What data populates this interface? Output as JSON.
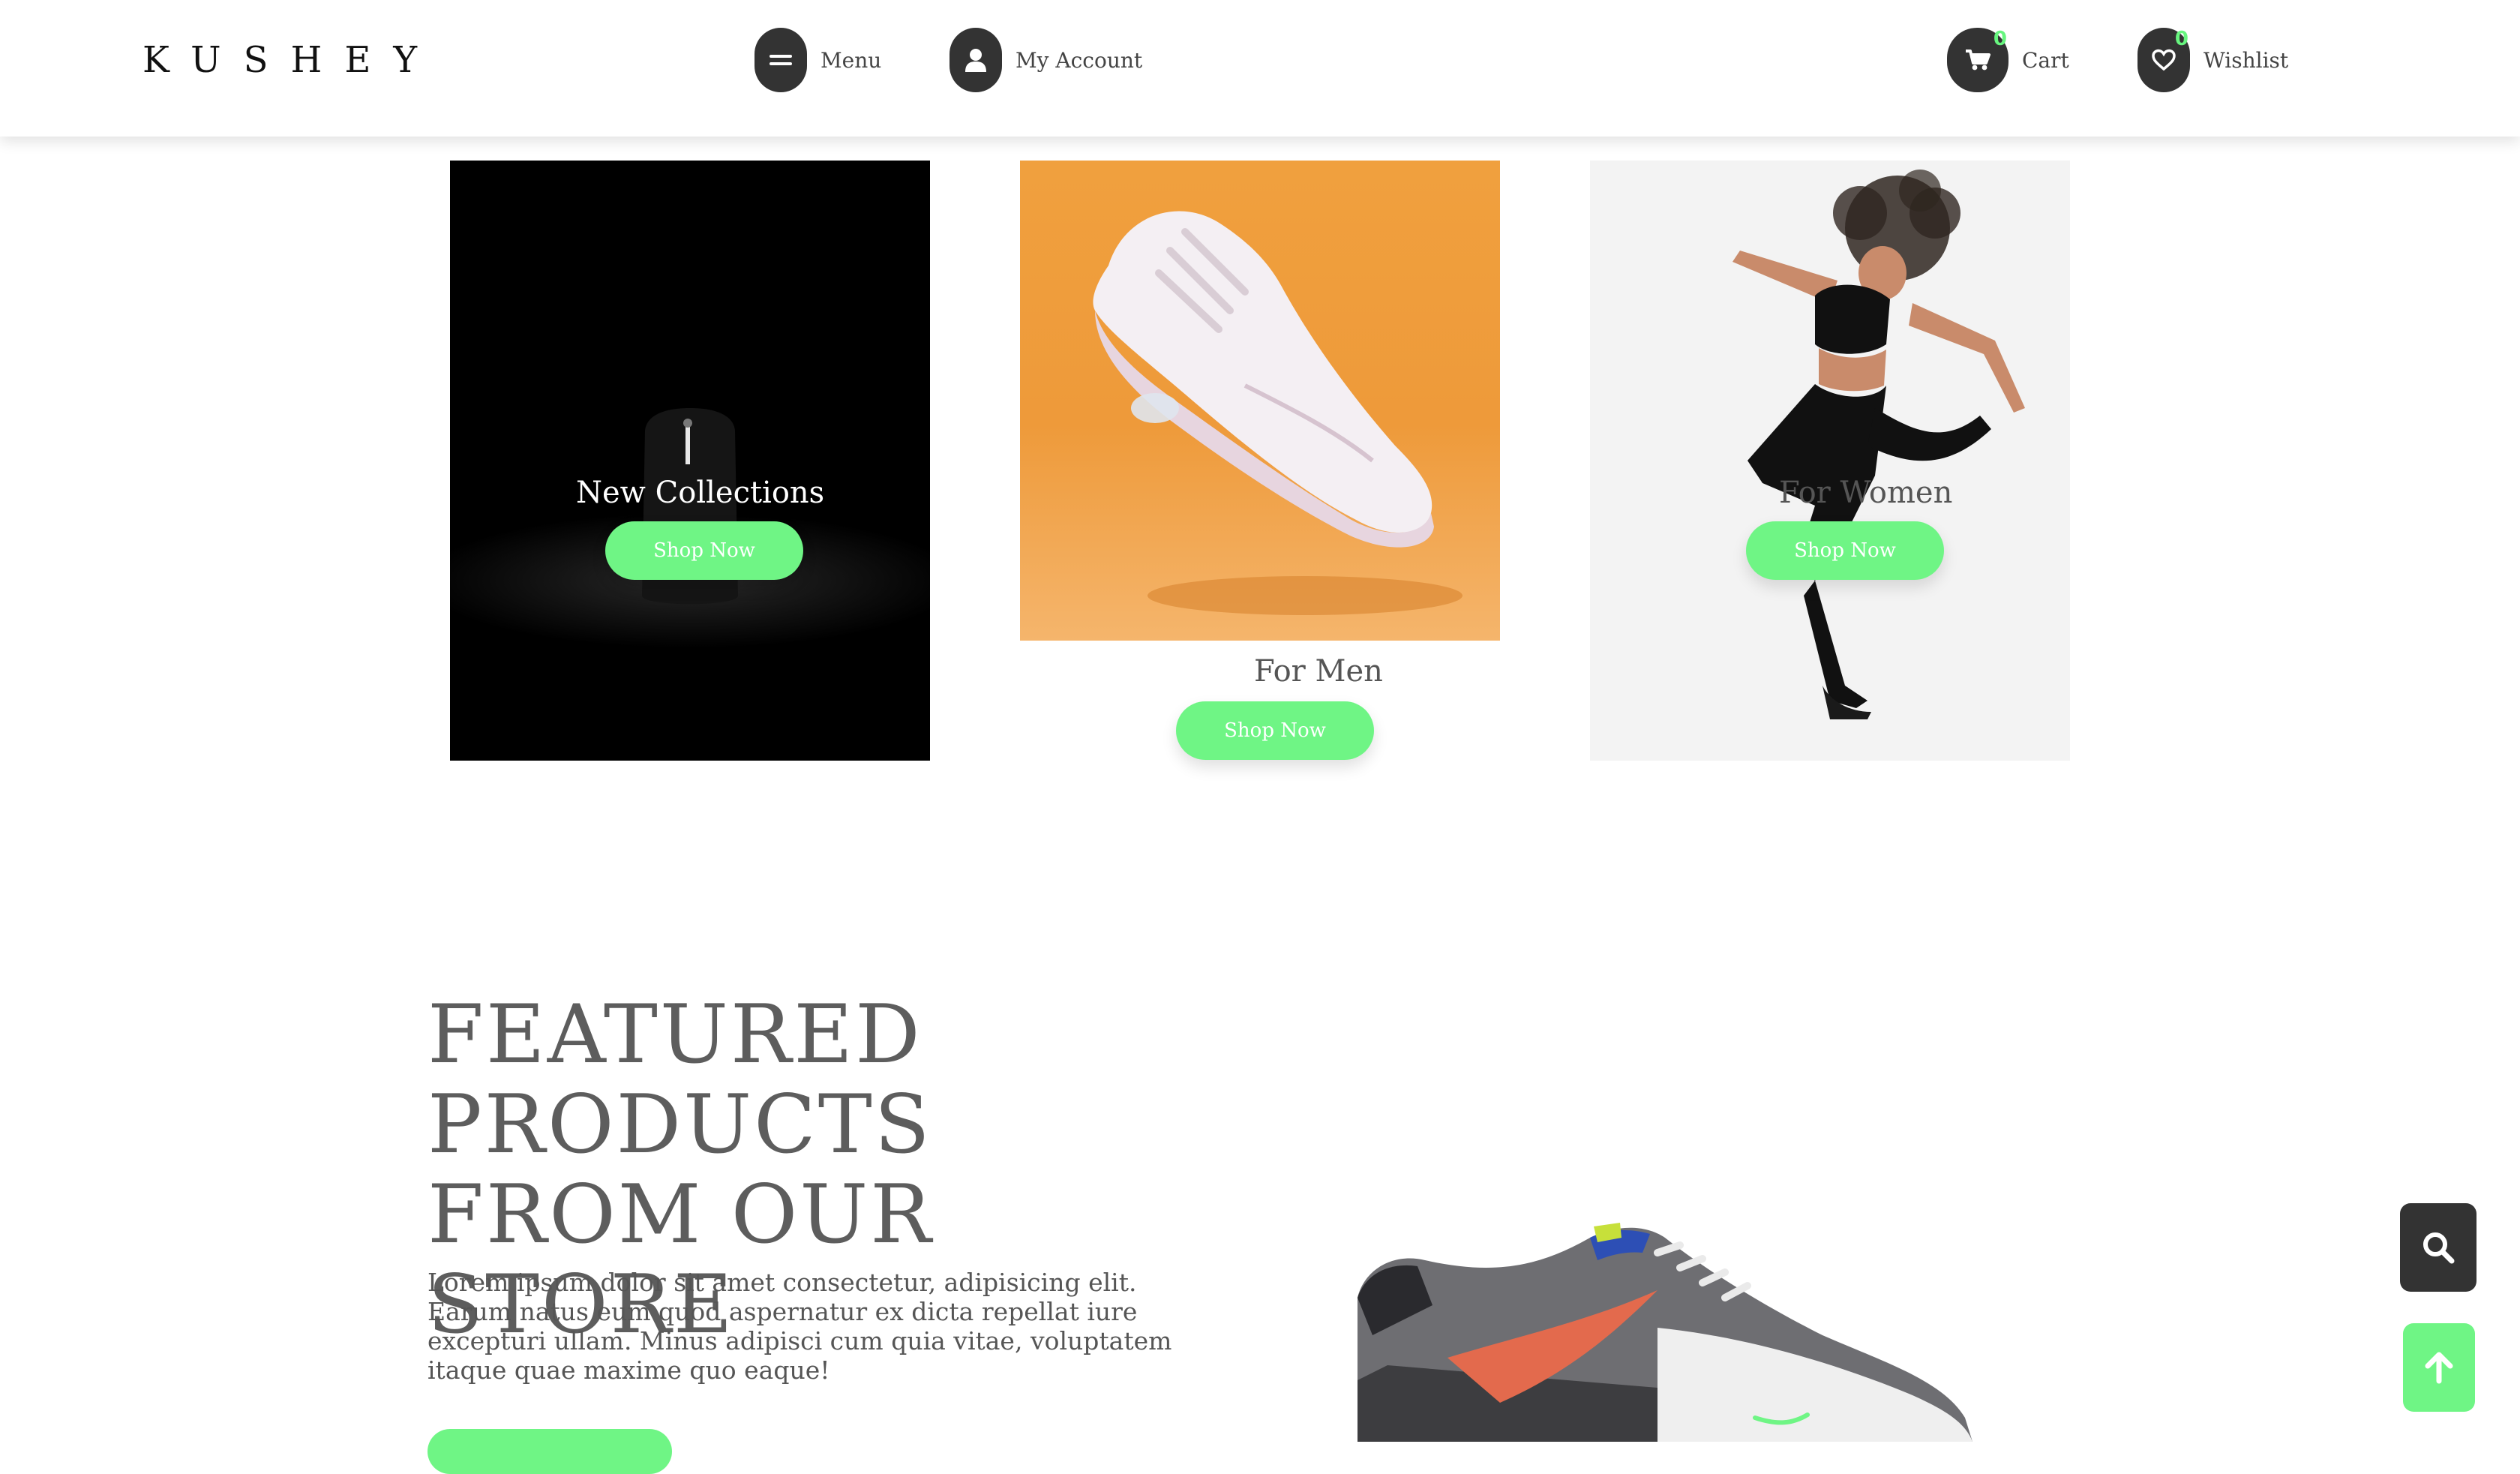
{
  "header": {
    "logo": "KUSHEY",
    "menu_label": "Menu",
    "account_label": "My Account",
    "cart_label": "Cart",
    "cart_count": "0",
    "wishlist_label": "Wishlist",
    "wishlist_count": "0"
  },
  "categories": [
    {
      "title": "New Collections",
      "button": "Shop Now"
    },
    {
      "title": "For Men",
      "button": "Shop Now"
    },
    {
      "title": "For Women",
      "button": "Shop Now"
    }
  ],
  "featured": {
    "title": "FEATURED PRODUCTS FROM OUR STORE",
    "text": "Lorem ipsum dolor sit amet consectetur, adipisicing elit. Earum natus eum quod aspernatur ex dicta repellat iure excepturi ullam. Minus adipisci cum quia vitae, voluptatem itaque quae maxime quo eaque!"
  },
  "colors": {
    "accent": "#6ff585",
    "dark": "#333333",
    "card_orange": "#ef9a3a"
  },
  "icons": {
    "menu": "menu-icon",
    "account": "user-icon",
    "cart": "cart-icon",
    "wishlist": "heart-icon",
    "search": "search-icon",
    "top": "arrow-up-icon"
  }
}
